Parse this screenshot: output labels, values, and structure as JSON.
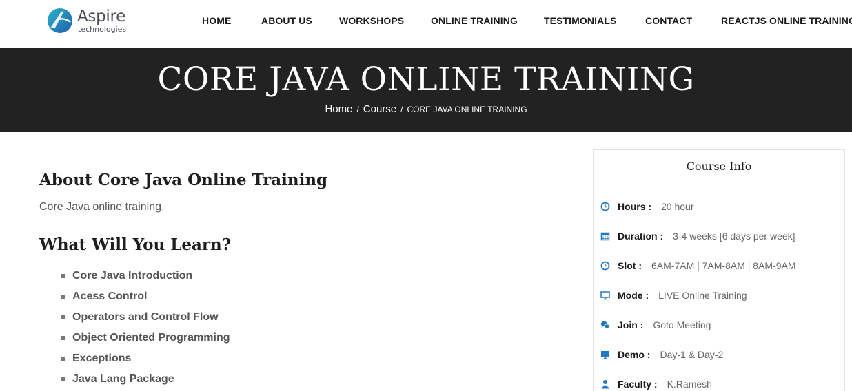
{
  "brand": {
    "name": "Aspire",
    "tagline": "technologies",
    "accent_color": "#1f78c1"
  },
  "nav": {
    "items": [
      {
        "label": "HOME"
      },
      {
        "label": "ABOUT US"
      },
      {
        "label": "WORKSHOPS"
      },
      {
        "label": "ONLINE TRAINING"
      },
      {
        "label": "TESTIMONIALS"
      },
      {
        "label": "CONTACT"
      },
      {
        "label": "REACTJS ONLINE TRAINING"
      }
    ]
  },
  "banner": {
    "title": "CORE JAVA ONLINE TRAINING",
    "breadcrumb": {
      "home": "Home",
      "course": "Course",
      "separator": "/",
      "current": "CORE JAVA ONLINE TRAINING"
    }
  },
  "main": {
    "about_title": "About Core Java Online Training",
    "about_text": "Core Java online training.",
    "learn_title": "What Will You Learn?",
    "learn_items": [
      "Core Java Introduction",
      "Acess Control",
      "Operators and Control Flow",
      "Object Oriented Programming",
      "Exceptions",
      "Java Lang Package"
    ]
  },
  "course_info": {
    "title": "Course Info",
    "rows": [
      {
        "icon": "clock-icon",
        "label": "Hours :",
        "value": "20 hour"
      },
      {
        "icon": "calendar-icon",
        "label": "Duration :",
        "value": "3-4 weeks [6 days per week]"
      },
      {
        "icon": "clock-icon",
        "label": "Slot :",
        "value": "6AM-7AM | 7AM-8AM | 8AM-9AM"
      },
      {
        "icon": "monitor-icon",
        "label": "Mode :",
        "value": "LIVE Online Training"
      },
      {
        "icon": "chat-icon",
        "label": "Join :",
        "value": "Goto Meeting"
      },
      {
        "icon": "monitor-icon",
        "label": "Demo :",
        "value": "Day-1 & Day-2"
      },
      {
        "icon": "user-icon",
        "label": "Faculty :",
        "value": "K.Ramesh"
      }
    ]
  }
}
